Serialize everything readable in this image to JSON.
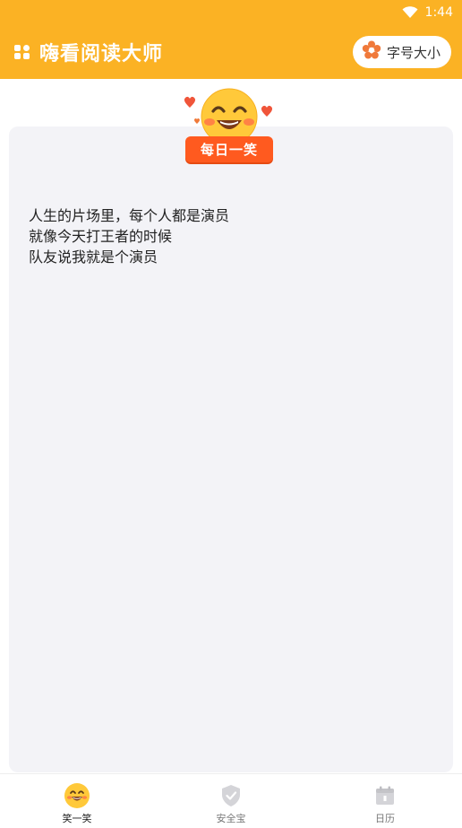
{
  "status_bar": {
    "time": "1:44"
  },
  "app_bar": {
    "title": "嗨看阅读大师",
    "font_button_label": "字号大小"
  },
  "badge": {
    "label": "每日一笑"
  },
  "joke": {
    "lines": [
      "人生的片场里，每个人都是演员",
      "就像今天打王者的时候",
      "队友说我就是个演员"
    ]
  },
  "bottom_nav": {
    "items": [
      {
        "label": "笑一笑",
        "icon": "smiley-icon",
        "active": true
      },
      {
        "label": "安全宝",
        "icon": "shield-icon",
        "active": false
      },
      {
        "label": "日历",
        "icon": "calendar-icon",
        "active": false
      }
    ]
  },
  "colors": {
    "accent": "#fbb224",
    "badge": "#ff5a1f",
    "card_bg": "#f3f3f7"
  }
}
